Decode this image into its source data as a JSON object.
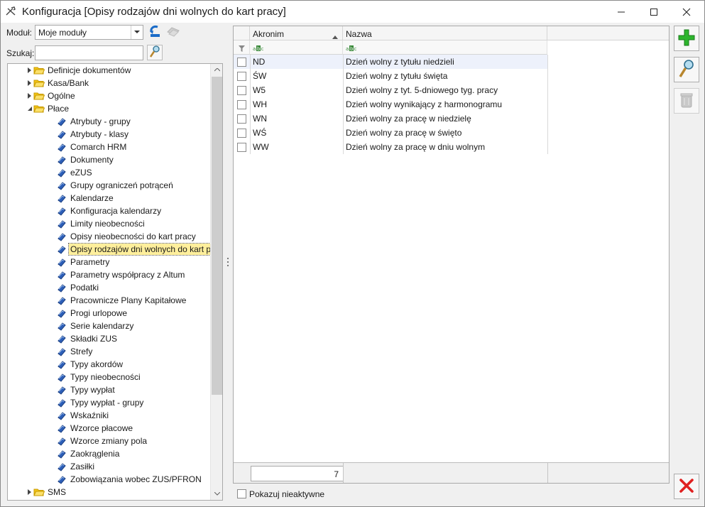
{
  "window": {
    "title": "Konfiguracja [Opisy rodzajów dni wolnych do kart pracy]"
  },
  "left": {
    "module_label": "Moduł:",
    "module_value": "Moje moduły",
    "search_label": "Szukaj:",
    "search_value": ""
  },
  "tree": {
    "items": [
      {
        "label": "Definicje dokumentów"
      },
      {
        "label": "Kasa/Bank"
      },
      {
        "label": "Ogólne"
      },
      {
        "label": "Płace"
      },
      {
        "label": "Atrybuty - grupy"
      },
      {
        "label": "Atrybuty - klasy"
      },
      {
        "label": "Comarch HRM"
      },
      {
        "label": "Dokumenty"
      },
      {
        "label": "eZUS"
      },
      {
        "label": "Grupy ograniczeń potrąceń"
      },
      {
        "label": "Kalendarze"
      },
      {
        "label": "Konfiguracja kalendarzy"
      },
      {
        "label": "Limity nieobecności"
      },
      {
        "label": "Opisy nieobecności do kart pracy"
      },
      {
        "label": "Opisy rodzajów dni wolnych do kart pracy"
      },
      {
        "label": "Parametry"
      },
      {
        "label": "Parametry współpracy z Altum"
      },
      {
        "label": "Podatki"
      },
      {
        "label": "Pracownicze Plany Kapitałowe"
      },
      {
        "label": "Progi urlopowe"
      },
      {
        "label": "Serie kalendarzy"
      },
      {
        "label": "Składki ZUS"
      },
      {
        "label": "Strefy"
      },
      {
        "label": "Typy akordów"
      },
      {
        "label": "Typy nieobecności"
      },
      {
        "label": "Typy wypłat"
      },
      {
        "label": "Typy wypłat - grupy"
      },
      {
        "label": "Wskaźniki"
      },
      {
        "label": "Wzorce płacowe"
      },
      {
        "label": "Wzorce zmiany pola"
      },
      {
        "label": "Zaokrąglenia"
      },
      {
        "label": "Zasiłki"
      },
      {
        "label": "Zobowiązania wobec ZUS/PFRON"
      },
      {
        "label": "SMS"
      }
    ]
  },
  "grid": {
    "col_akronim": "Akronim",
    "col_nazwa": "Nazwa",
    "rows": [
      {
        "akronim": "ND",
        "nazwa": "Dzień wolny z tytułu niedzieli"
      },
      {
        "akronim": "ŚW",
        "nazwa": "Dzień wolny z tytułu święta"
      },
      {
        "akronim": "W5",
        "nazwa": "Dzień wolny z tyt. 5-dniowego tyg. pracy"
      },
      {
        "akronim": "WH",
        "nazwa": "Dzień wolny wynikający z harmonogramu"
      },
      {
        "akronim": "WN",
        "nazwa": "Dzień wolny za pracę w niedzielę"
      },
      {
        "akronim": "WŚ",
        "nazwa": "Dzień wolny za pracę w święto"
      },
      {
        "akronim": "WW",
        "nazwa": "Dzień wolny za pracę w dniu wolnym"
      }
    ],
    "count": "7",
    "show_inactive_label": "Pokazuj nieaktywne"
  },
  "colors": {
    "selected_tree_bg": "#ffef9c",
    "active_row_bg": "#edf1fb",
    "add_green": "#2db52d",
    "close_red": "#e02020"
  }
}
